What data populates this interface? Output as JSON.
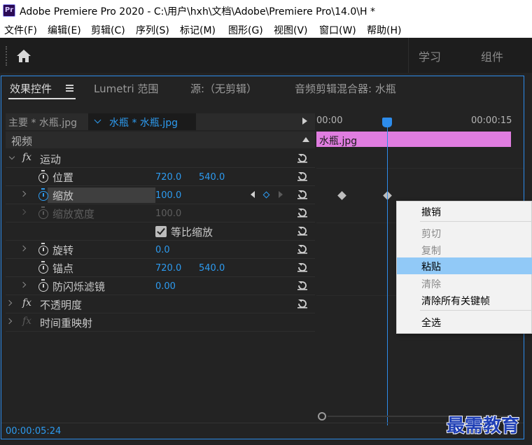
{
  "window": {
    "app_icon": "Pr",
    "title": "Adobe Premiere Pro 2020 - C:\\用户\\hxh\\文档\\Adobe\\Premiere Pro\\14.0\\H *"
  },
  "menu": [
    "文件(F)",
    "编辑(E)",
    "剪辑(C)",
    "序列(S)",
    "标记(M)",
    "图形(G)",
    "视图(V)",
    "窗口(W)",
    "帮助(H)"
  ],
  "workspace": {
    "home_icon": "home-icon",
    "tabs": [
      "学习",
      "组件"
    ]
  },
  "panel_tabs": {
    "effect_controls": "效果控件",
    "lumetri": "Lumetri 范围",
    "source": "源:（无剪辑）",
    "audio_mixer": "音频剪辑混合器: 水瓶"
  },
  "clip_header": {
    "master": "主要 * 水瓶.jpg",
    "selected": "水瓶 * 水瓶.jpg"
  },
  "section": {
    "video": "视频"
  },
  "effects": {
    "motion": "运动",
    "position": {
      "label": "位置",
      "x": "720.0",
      "y": "540.0"
    },
    "scale": {
      "label": "缩放",
      "value": "100.0"
    },
    "scale_width": {
      "label": "缩放宽度",
      "value": "100.0"
    },
    "uniform_scale": {
      "label": "等比缩放",
      "checked": true
    },
    "rotation": {
      "label": "旋转",
      "value": "0.0"
    },
    "anchor": {
      "label": "锚点",
      "x": "720.0",
      "y": "540.0"
    },
    "anti_flicker": {
      "label": "防闪烁滤镜",
      "value": "0.00"
    },
    "opacity": "不透明度",
    "time_remap": "时间重映射"
  },
  "timeline": {
    "start": "00:00",
    "end": "00:00:15",
    "clip_name": "水瓶.jpg",
    "playhead": "00:00:05:24"
  },
  "footer": {
    "timecode": "00:00:05:24"
  },
  "context_menu": {
    "items": [
      {
        "label": "撤销",
        "enabled": true
      },
      {
        "label": "剪切",
        "enabled": false
      },
      {
        "label": "复制",
        "enabled": false
      },
      {
        "label": "粘贴",
        "enabled": true,
        "highlighted": true
      },
      {
        "label": "清除",
        "enabled": false
      },
      {
        "label": "清除所有关键帧",
        "enabled": true
      },
      {
        "label": "全选",
        "enabled": true
      }
    ]
  },
  "watermark": "最需教育",
  "colors": {
    "accent": "#2d9bf0",
    "clip": "#e07de0",
    "menu_highlight": "#91c9f7",
    "panel_border": "#2d8ceb"
  }
}
